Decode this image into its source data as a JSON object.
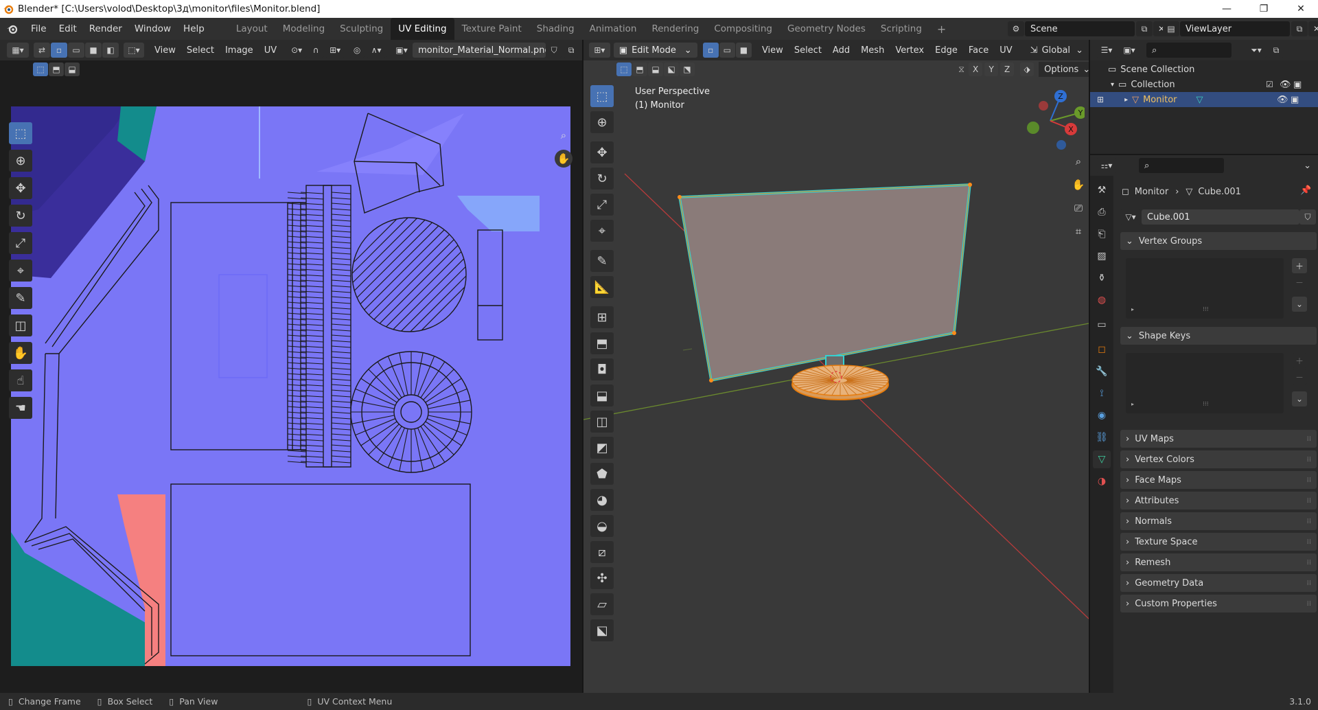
{
  "window": {
    "title": "Blender* [C:\\Users\\volod\\Desktop\\3д\\monitor\\files\\Monitor.blend]",
    "min": "—",
    "max": "❐",
    "close": "✕"
  },
  "menu": [
    "File",
    "Edit",
    "Render",
    "Window",
    "Help"
  ],
  "workspaces": [
    "Layout",
    "Modeling",
    "Sculpting",
    "UV Editing",
    "Texture Paint",
    "Shading",
    "Animation",
    "Rendering",
    "Compositing",
    "Geometry Nodes",
    "Scripting"
  ],
  "active_workspace": "UV Editing",
  "add_workspace": "+",
  "scene": {
    "name": "Scene",
    "view_layer": "ViewLayer"
  },
  "uv_editor": {
    "menus": [
      "View",
      "Select",
      "Image",
      "UV"
    ],
    "image_name": "monitor_Material_Normal.png",
    "colors": {
      "background": "#7a76f6",
      "dark_blue": "#3a2e9b",
      "teal": "#138c8c",
      "salmon": "#f58080"
    }
  },
  "viewport": {
    "mode": "Edit Mode",
    "menus": [
      "View",
      "Select",
      "Add",
      "Mesh",
      "Vertex",
      "Edge",
      "Face",
      "UV"
    ],
    "orientation": "Global",
    "axes": [
      "X",
      "Y",
      "Z"
    ],
    "options": "Options",
    "overlay_title": "User Perspective",
    "overlay_object": "(1) Monitor",
    "gizmo": {
      "z": "Z",
      "y": "Y",
      "x": "X"
    }
  },
  "outliner": {
    "scene_collection": "Scene Collection",
    "collection": "Collection",
    "object": "Monitor"
  },
  "properties": {
    "breadcrumb_object": "Monitor",
    "breadcrumb_mesh": "Cube.001",
    "mesh_name": "Cube.001",
    "panels": [
      {
        "label": "Vertex Groups",
        "open": true
      },
      {
        "label": "Shape Keys",
        "open": true
      },
      {
        "label": "UV Maps",
        "open": false
      },
      {
        "label": "Vertex Colors",
        "open": false
      },
      {
        "label": "Face Maps",
        "open": false
      },
      {
        "label": "Attributes",
        "open": false
      },
      {
        "label": "Normals",
        "open": false
      },
      {
        "label": "Texture Space",
        "open": false
      },
      {
        "label": "Remesh",
        "open": false
      },
      {
        "label": "Geometry Data",
        "open": false
      },
      {
        "label": "Custom Properties",
        "open": false
      }
    ]
  },
  "status": {
    "change_frame": "Change Frame",
    "box_select": "Box Select",
    "pan_view": "Pan View",
    "uv_menu": "UV Context Menu",
    "version": "3.1.0"
  }
}
